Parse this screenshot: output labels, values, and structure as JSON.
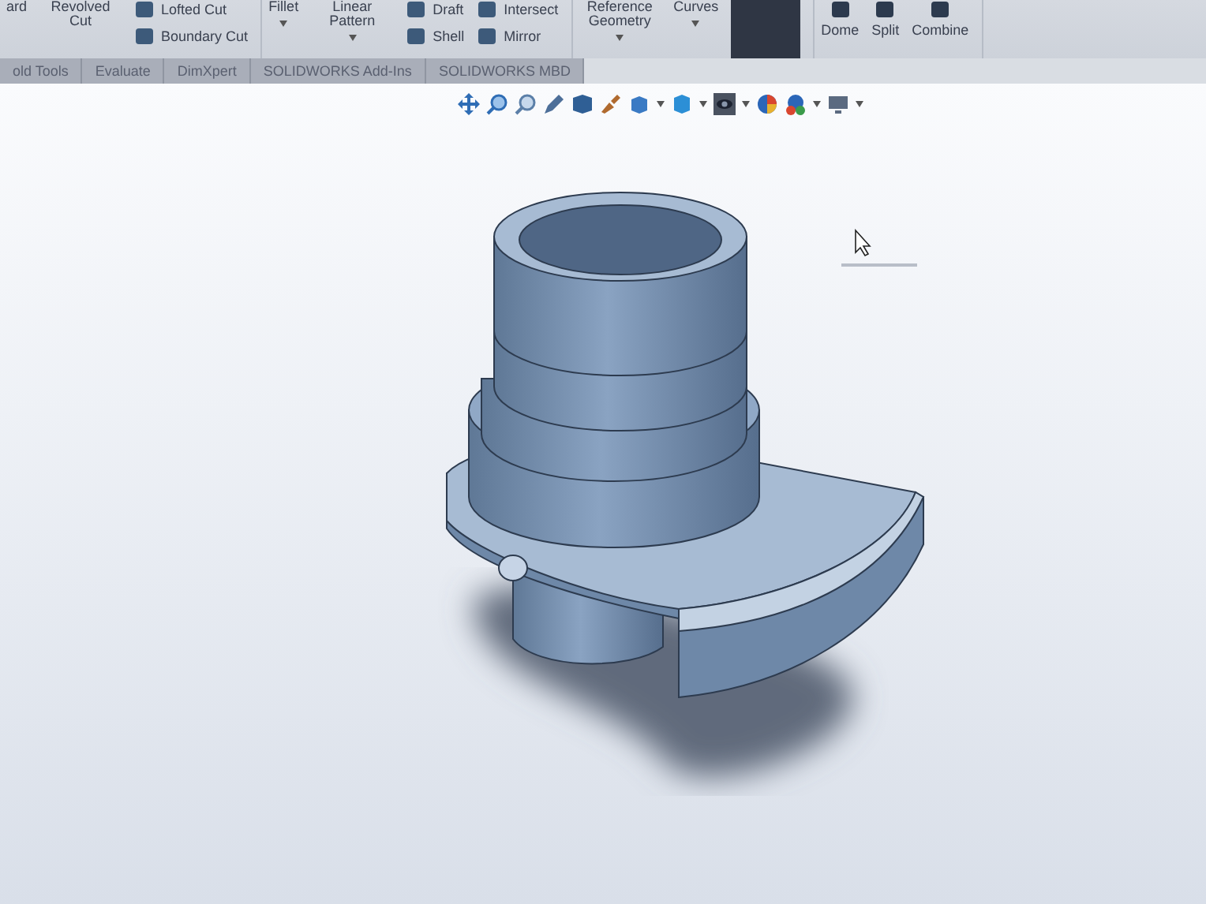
{
  "ribbon": {
    "groups": [
      {
        "columns": [
          {
            "kind": "large",
            "label": "ard",
            "dropdown": false
          },
          {
            "kind": "large",
            "label": "Revolved Cut",
            "dropdown": false
          },
          {
            "kind": "stack",
            "items": [
              "Lofted Cut",
              "Boundary Cut"
            ]
          }
        ]
      },
      {
        "columns": [
          {
            "kind": "large",
            "label": "Fillet",
            "dropdown": true
          },
          {
            "kind": "large",
            "label": "Linear Pattern",
            "dropdown": true
          },
          {
            "kind": "stack",
            "items": [
              "Draft",
              "Shell"
            ]
          },
          {
            "kind": "stack",
            "items": [
              "Intersect",
              "Mirror"
            ]
          }
        ]
      },
      {
        "columns": [
          {
            "kind": "large",
            "label": "Reference Geometry",
            "dropdown": true
          },
          {
            "kind": "large",
            "label": "Curves",
            "dropdown": true
          },
          {
            "kind": "dark"
          }
        ]
      },
      {
        "columns": [
          {
            "kind": "small",
            "label": "Dome"
          },
          {
            "kind": "small",
            "label": "Split"
          },
          {
            "kind": "small",
            "label": "Combine"
          }
        ]
      }
    ]
  },
  "tabs": [
    {
      "label": "old Tools"
    },
    {
      "label": "Evaluate"
    },
    {
      "label": "DimXpert"
    },
    {
      "label": "SOLIDWORKS Add-Ins"
    },
    {
      "label": "SOLIDWORKS MBD"
    }
  ]
}
